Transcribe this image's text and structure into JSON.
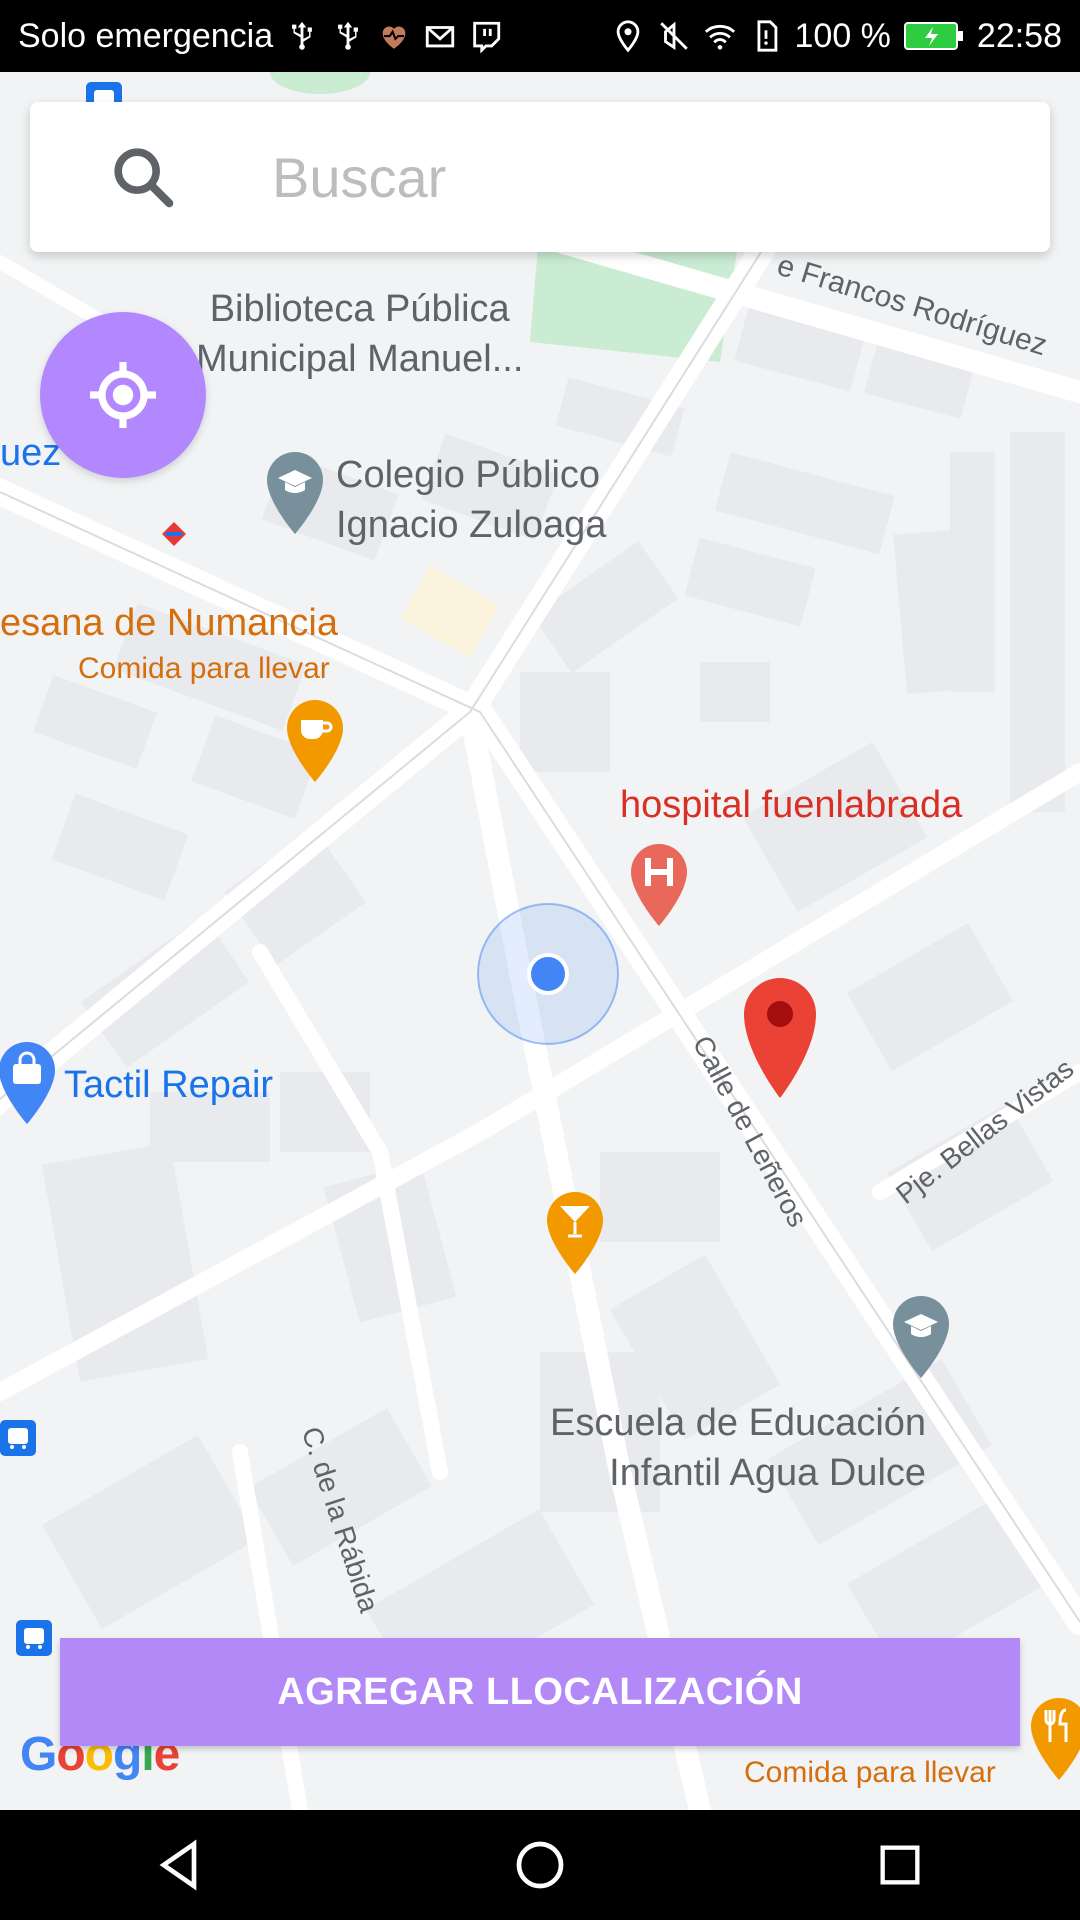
{
  "status_bar": {
    "carrier": "Solo emergencia",
    "battery_percent": "100 %",
    "time": "22:58",
    "left_icons": [
      "usb-icon",
      "usb-icon",
      "heart-icon",
      "mail-icon",
      "twitch-icon"
    ],
    "right_icons": [
      "location-icon",
      "mute-icon",
      "wifi-icon",
      "sim-alert-icon",
      "battery-charging-icon"
    ]
  },
  "search": {
    "placeholder": "Buscar"
  },
  "map": {
    "places": {
      "biblioteca_line1": "Biblioteca Pública",
      "biblioteca_line2": "Municipal Manuel...",
      "colegio_line1": "Colegio Público",
      "colegio_line2": "Ignacio Zuloaga",
      "numancia": "esana de Numancia",
      "numancia_sub": "Comida para llevar",
      "uez": "uez",
      "hospital": "hospital fuenlabrada",
      "tactil": "Tactil Repair",
      "escuela_line1": "Escuela de Educación",
      "escuela_line2": "Infantil Agua Dulce",
      "food_bottom": "Comida para llevar"
    },
    "streets": {
      "francos": "e Francos Rodríguez",
      "calle_lenheros": "Calle de Leñeros",
      "bellas_vistas": "Pje. Bellas Vistas",
      "rabida": "C. de la Rábida"
    },
    "colors": {
      "accent": "#b388f7",
      "marker_red": "#ea4335",
      "poi_orange": "#f29900",
      "hospital_pin": "#e8685b",
      "user_location": "#4285f4"
    }
  },
  "buttons": {
    "add_location": "AGREGAR LLOCALIZACIÓN"
  },
  "google_logo": "Google",
  "nav": [
    "back-icon",
    "home-icon",
    "recents-icon"
  ]
}
